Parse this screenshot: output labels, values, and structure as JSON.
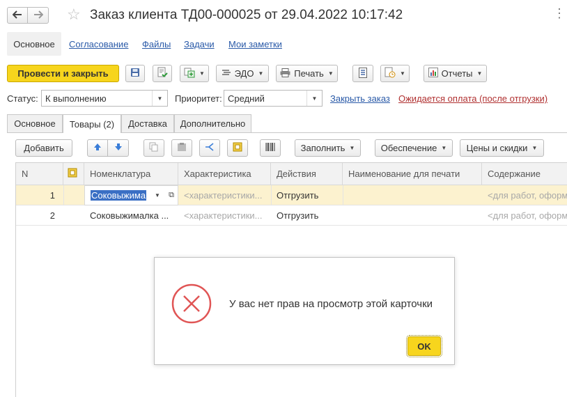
{
  "window": {
    "title": "Заказ клиента ТД00-000025 от 29.04.2022 10:17:42"
  },
  "sections": [
    "Основное",
    "Согласование",
    "Файлы",
    "Задачи",
    "Мои заметки"
  ],
  "toolbar": {
    "post_close": "Провести и закрыть",
    "edo": "ЭДО",
    "print": "Печать",
    "reports": "Отчеты"
  },
  "fields": {
    "status_label": "Статус:",
    "status_value": "К выполнению",
    "priority_label": "Приоритет:",
    "priority_value": "Средний",
    "close_order_link": "Закрыть заказ",
    "payment_status": "Ожидается оплата (после отгрузки)"
  },
  "tabs": [
    "Основное",
    "Товары (2)",
    "Доставка",
    "Дополнительно"
  ],
  "table_toolbar": {
    "add": "Добавить",
    "fill": "Заполнить",
    "supply": "Обеспечение",
    "prices": "Цены и скидки"
  },
  "table": {
    "columns": [
      "N",
      "Номенклатура",
      "Характеристика",
      "Действия",
      "Наименование для печати",
      "Содержание"
    ],
    "rows": [
      {
        "n": "1",
        "item": "Соковыжима",
        "char": "<характеристики...",
        "action": "Отгрузить",
        "print_name": "",
        "content": "<для работ, оформ..."
      },
      {
        "n": "2",
        "item": "Соковыжималка ...",
        "char": "<характеристики...",
        "action": "Отгрузить",
        "print_name": "",
        "content": "<для работ, оформ..."
      }
    ]
  },
  "dialog": {
    "message": "У вас нет прав на просмотр этой карточки",
    "ok": "OK"
  },
  "colors": {
    "accent_yellow": "#f7d51d",
    "link_blue": "#2a5aa8",
    "warning_red": "#b03030",
    "selected_row": "#fcf2cf",
    "error_icon": "#e05555"
  }
}
